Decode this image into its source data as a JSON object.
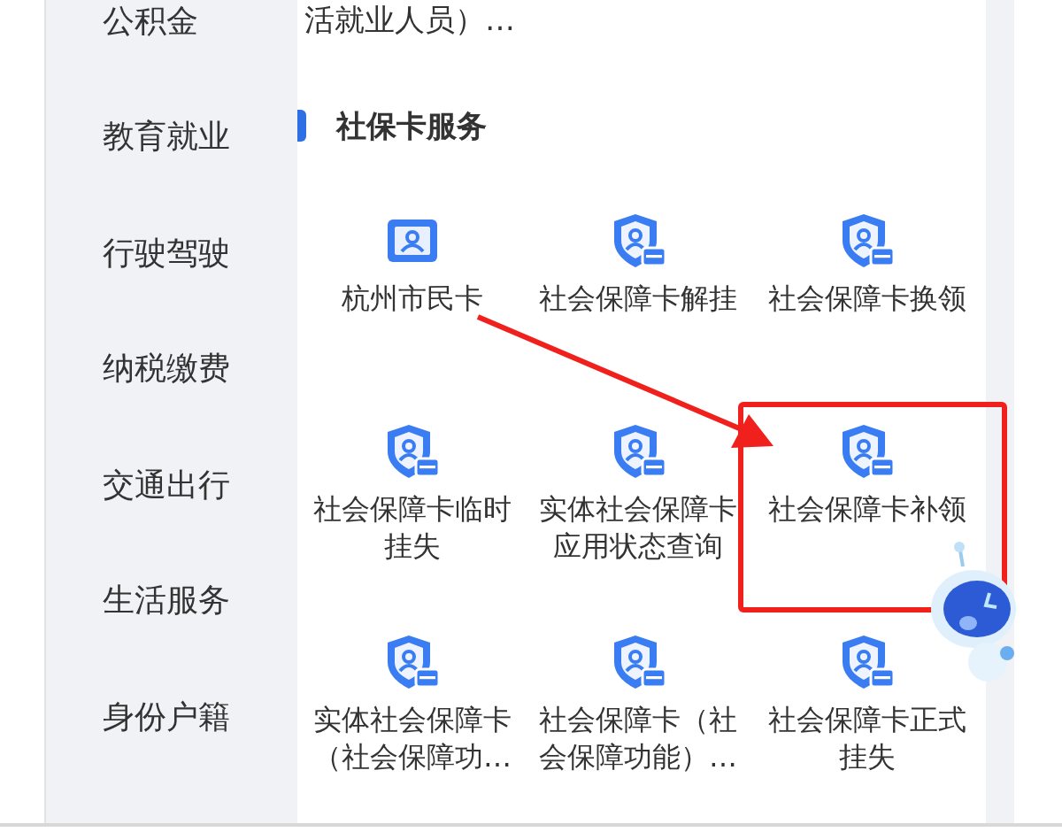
{
  "sidebar": {
    "items": [
      {
        "label": "公积金"
      },
      {
        "label": "教育就业"
      },
      {
        "label": "行驶驾驶"
      },
      {
        "label": "纳税缴费"
      },
      {
        "label": "交通出行"
      },
      {
        "label": "生活服务"
      },
      {
        "label": "身份户籍"
      }
    ]
  },
  "content": {
    "previous_item_tail": "活就业人员）…",
    "section": {
      "title": "社保卡服务",
      "items": [
        {
          "kind": "id-card",
          "lines": [
            "杭州市民卡"
          ],
          "highlighted": false
        },
        {
          "kind": "shield-card",
          "lines": [
            "社会保障卡解挂"
          ],
          "highlighted": false
        },
        {
          "kind": "shield-card",
          "lines": [
            "社会保障卡换领"
          ],
          "highlighted": false
        },
        {
          "kind": "shield-card",
          "lines": [
            "社会保障卡临时",
            "挂失"
          ],
          "highlighted": false
        },
        {
          "kind": "shield-card",
          "lines": [
            "实体社会保障卡",
            "应用状态查询"
          ],
          "highlighted": false
        },
        {
          "kind": "shield-card",
          "lines": [
            "社会保障卡补领"
          ],
          "highlighted": true
        },
        {
          "kind": "shield-card",
          "lines": [
            "实体社会保障卡",
            "（社会保障功…"
          ],
          "highlighted": false
        },
        {
          "kind": "shield-card",
          "lines": [
            "社会保障卡（社",
            "会保障功能）…"
          ],
          "highlighted": false
        },
        {
          "kind": "shield-card",
          "lines": [
            "社会保障卡正式",
            "挂失"
          ],
          "highlighted": false
        }
      ]
    }
  }
}
